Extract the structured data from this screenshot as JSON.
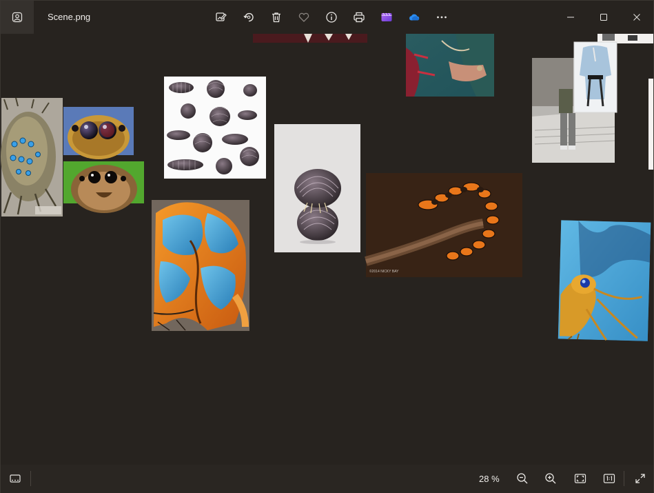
{
  "titlebar": {
    "filename": "Scene.png",
    "app_icon": "photos-app-icon",
    "toolbar": [
      {
        "name": "edit-image-button",
        "icon": "edit-image-icon"
      },
      {
        "name": "rotate-button",
        "icon": "rotate-icon"
      },
      {
        "name": "delete-button",
        "icon": "trash-icon"
      },
      {
        "name": "favorite-button",
        "icon": "heart-icon"
      },
      {
        "name": "file-info-button",
        "icon": "info-icon"
      },
      {
        "name": "print-button",
        "icon": "printer-icon"
      },
      {
        "name": "clipchamp-button",
        "icon": "clipchamp-icon"
      },
      {
        "name": "onedrive-button",
        "icon": "onedrive-cloud-icon"
      },
      {
        "name": "more-options-button",
        "icon": "more-horizontal-icon"
      }
    ],
    "window_controls": [
      "minimize",
      "maximize",
      "close"
    ]
  },
  "canvas": {
    "tiles": [
      "fantasy-beetle-blue-gems",
      "jumping-spider-eyes-blue",
      "jumping-spider-face-green",
      "pill-bugs-collection",
      "orange-blue-beetle-closeup",
      "stacked-pill-bugs",
      "dark-red-strip",
      "woman-teal-dress-jewelry",
      "millipede-on-branch",
      "streetwear-outfit-photo",
      "clothing-flatlay",
      "blue-golden-beetle-art"
    ],
    "colors": {
      "background": "#27231f",
      "accent_orange": "#e8761a",
      "accent_blue": "#3b9fd4"
    }
  },
  "bottombar": {
    "zoom": "28 %",
    "buttons": [
      "filmstrip",
      "zoom-out",
      "zoom-in",
      "fit-to-window",
      "actual-size",
      "fullscreen"
    ]
  }
}
